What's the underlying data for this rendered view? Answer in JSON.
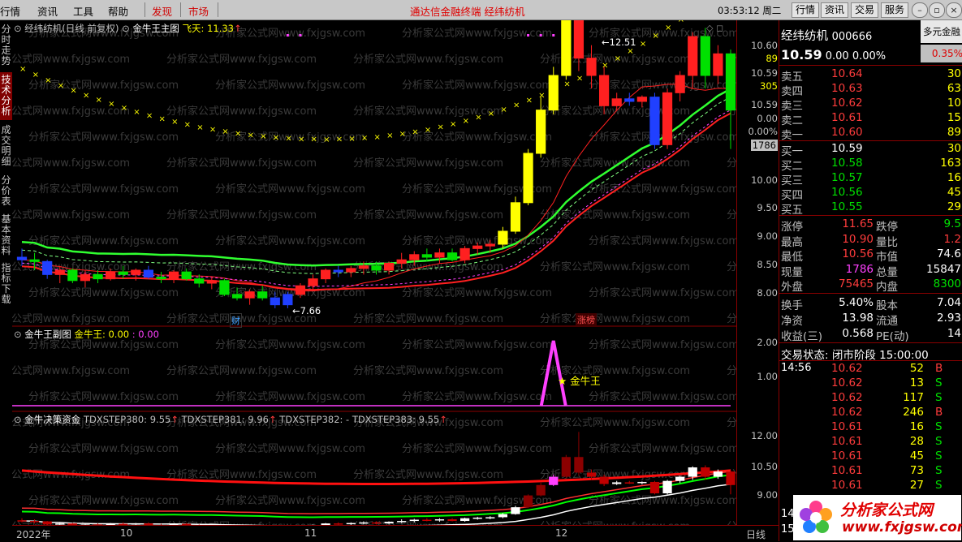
{
  "menu": {
    "items": [
      "行情",
      "资讯",
      "工具",
      "帮助"
    ],
    "red_items": [
      "发现",
      "市场"
    ],
    "title": "通达信金融终端  经纬纺机",
    "clock": "03:53:12 周二",
    "buttons": [
      "行情",
      "资讯",
      "交易",
      "服务"
    ]
  },
  "left_tabs": [
    {
      "label": "分时走势",
      "active": false
    },
    {
      "label": "技术分析",
      "active": true
    },
    {
      "label": "成交明细",
      "active": false
    },
    {
      "label": "分价表",
      "active": false
    },
    {
      "label": "基本资料",
      "active": false
    },
    {
      "label": "指标下载",
      "active": false
    }
  ],
  "main_pane": {
    "title": "经纬纺机(日线 前复权)",
    "indicator": "金牛王主图",
    "fly_label": "飞天: 11.33",
    "high_label": "12.51",
    "low_label": "7.66",
    "badge_cai": "财",
    "badge_zhb": "涨榜",
    "y_labels": [
      "10.60",
      "89",
      "10.59",
      "305",
      "10.59",
      "0.00",
      "0.00%",
      "1786",
      "10.00",
      "9.50",
      "9.00",
      "8.50",
      "8.00"
    ]
  },
  "sub_pane": {
    "title": "金牛王副图",
    "value_label": "金牛王: 0.00",
    "value2": ": 0.00",
    "star_label": "★ 金牛王",
    "y_labels": [
      "2.00",
      "1.00"
    ]
  },
  "bottom_pane": {
    "title": "金牛决策资金",
    "s380": "TDXSTEP380: 9.55",
    "s381": "TDXSTEP381: 9.96",
    "s382": "TDXSTEP382: -",
    "s383": "TDXSTEP383: 9.55",
    "y_labels": [
      "12.00",
      "10.50",
      "9.00"
    ]
  },
  "x_axis": {
    "labels": [
      "2022年",
      "10",
      "11",
      "12"
    ],
    "period": "日线"
  },
  "quote": {
    "name": "经纬纺机",
    "code": "000666",
    "side_label": "多元金融",
    "price": "10.59",
    "change": "0.00",
    "change_pct": "0.00%",
    "side_pct": "0.35%",
    "asks": [
      {
        "label": "卖五",
        "price": "10.64",
        "vol": "30"
      },
      {
        "label": "卖四",
        "price": "10.63",
        "vol": "63"
      },
      {
        "label": "卖三",
        "price": "10.62",
        "vol": "10"
      },
      {
        "label": "卖二",
        "price": "10.61",
        "vol": "15"
      },
      {
        "label": "卖一",
        "price": "10.60",
        "vol": "89"
      }
    ],
    "bids": [
      {
        "label": "买一",
        "price": "10.59",
        "vol": "30"
      },
      {
        "label": "买二",
        "price": "10.58",
        "vol": "163"
      },
      {
        "label": "买三",
        "price": "10.57",
        "vol": "16"
      },
      {
        "label": "买四",
        "price": "10.56",
        "vol": "45"
      },
      {
        "label": "买五",
        "price": "10.55",
        "vol": "29"
      }
    ],
    "stats": [
      {
        "l1": "涨停",
        "v1": "11.65",
        "c1": "red",
        "l2": "跌停",
        "v2": "9.5",
        "c2": "green"
      },
      {
        "l1": "最高",
        "v1": "10.90",
        "c1": "red",
        "l2": "量比",
        "v2": "1.2",
        "c2": "red"
      },
      {
        "l1": "最低",
        "v1": "10.56",
        "c1": "red",
        "l2": "市值",
        "v2": "74.6",
        "c2": "white"
      },
      {
        "l1": "现量",
        "v1": "1786",
        "c1": "magenta",
        "l2": "总量",
        "v2": "15847",
        "c2": "white"
      },
      {
        "l1": "外盘",
        "v1": "75465",
        "c1": "red",
        "l2": "内盘",
        "v2": "8300",
        "c2": "green"
      }
    ],
    "fund": [
      {
        "l1": "换手",
        "v1": "5.40%",
        "l2": "股本",
        "v2": "7.04"
      },
      {
        "l1": "净资",
        "v1": "13.98",
        "l2": "流通",
        "v2": "2.93"
      },
      {
        "l1": "收益(三)",
        "v1": "0.568",
        "l2": "PE(动)",
        "v2": "14"
      }
    ],
    "status_label": "交易状态: 闭市阶段 15:00:00",
    "ticks_time": "14:56",
    "ticks": [
      {
        "price": "10.62",
        "vol": "52",
        "side": "B"
      },
      {
        "price": "10.62",
        "vol": "13",
        "side": "S"
      },
      {
        "price": "10.62",
        "vol": "117",
        "side": "S"
      },
      {
        "price": "10.62",
        "vol": "246",
        "side": "B"
      },
      {
        "price": "10.61",
        "vol": "16",
        "side": "S"
      },
      {
        "price": "10.61",
        "vol": "28",
        "side": "S"
      },
      {
        "price": "10.61",
        "vol": "45",
        "side": "S"
      },
      {
        "price": "10.61",
        "vol": "73",
        "side": "S"
      },
      {
        "price": "10.61",
        "vol": "27",
        "side": "S"
      }
    ],
    "tick_tail": [
      "14",
      "15"
    ]
  },
  "watermark": {
    "text": "分析家公式网",
    "url": "www.fxjgsw.com"
  },
  "colors": {
    "up": "#ff2020",
    "down": "#00e000",
    "bg": "#000000",
    "grid": "#8b0000"
  },
  "chart_data": {
    "type": "candlestick",
    "candles": [
      [
        8.25,
        8.35,
        8.15,
        8.22
      ],
      [
        8.22,
        8.3,
        8.1,
        8.2
      ],
      [
        8.2,
        8.22,
        8.0,
        8.05
      ],
      [
        8.05,
        8.15,
        7.95,
        8.1
      ],
      [
        8.1,
        8.12,
        7.95,
        7.98
      ],
      [
        7.98,
        8.1,
        7.9,
        8.05
      ],
      [
        8.05,
        8.1,
        7.95,
        8.0
      ],
      [
        8.0,
        8.12,
        7.98,
        8.08
      ],
      [
        8.08,
        8.15,
        8.0,
        8.05
      ],
      [
        8.05,
        8.12,
        7.98,
        8.1
      ],
      [
        8.1,
        8.15,
        8.0,
        8.02
      ],
      [
        8.02,
        8.08,
        7.95,
        8.0
      ],
      [
        8.0,
        8.1,
        7.95,
        8.08
      ],
      [
        8.08,
        8.12,
        7.98,
        8.0
      ],
      [
        8.0,
        8.05,
        7.9,
        7.95
      ],
      [
        7.95,
        8.02,
        7.88,
        7.98
      ],
      [
        7.98,
        8.0,
        7.8,
        7.82
      ],
      [
        7.82,
        7.9,
        7.75,
        7.78
      ],
      [
        7.78,
        7.88,
        7.7,
        7.85
      ],
      [
        7.85,
        7.92,
        7.75,
        7.78
      ],
      [
        7.78,
        7.85,
        7.66,
        7.7
      ],
      [
        7.7,
        7.85,
        7.66,
        7.82
      ],
      [
        7.82,
        7.95,
        7.78,
        7.92
      ],
      [
        7.92,
        8.05,
        7.88,
        8.0
      ],
      [
        8.0,
        8.12,
        7.95,
        8.1
      ],
      [
        8.1,
        8.15,
        8.02,
        8.08
      ],
      [
        8.08,
        8.15,
        8.02,
        8.12
      ],
      [
        8.12,
        8.2,
        8.05,
        8.15
      ],
      [
        8.15,
        8.2,
        8.05,
        8.1
      ],
      [
        8.1,
        8.2,
        8.05,
        8.18
      ],
      [
        8.18,
        8.3,
        8.12,
        8.22
      ],
      [
        8.22,
        8.32,
        8.15,
        8.28
      ],
      [
        8.28,
        8.35,
        8.2,
        8.25
      ],
      [
        8.25,
        8.35,
        8.18,
        8.3
      ],
      [
        8.3,
        8.35,
        8.2,
        8.22
      ],
      [
        8.22,
        8.38,
        8.18,
        8.35
      ],
      [
        8.35,
        8.42,
        8.28,
        8.38
      ],
      [
        8.38,
        8.45,
        8.3,
        8.4
      ],
      [
        8.4,
        8.6,
        8.35,
        8.55
      ],
      [
        8.55,
        8.95,
        8.52,
        8.88
      ],
      [
        8.88,
        9.5,
        8.85,
        9.45
      ],
      [
        9.45,
        10.1,
        9.4,
        9.95
      ],
      [
        9.95,
        10.45,
        9.9,
        10.35
      ],
      [
        10.35,
        11.4,
        10.3,
        11.3
      ],
      [
        11.3,
        12.51,
        10.4,
        10.55
      ],
      [
        10.55,
        10.7,
        10.2,
        10.35
      ],
      [
        10.35,
        10.45,
        9.9,
        10.0
      ],
      [
        10.0,
        10.15,
        9.95,
        10.08
      ],
      [
        10.08,
        10.15,
        10.0,
        10.05
      ],
      [
        10.05,
        10.12,
        9.98,
        10.1
      ],
      [
        10.1,
        10.15,
        9.5,
        9.55
      ],
      [
        9.55,
        10.2,
        9.5,
        10.15
      ],
      [
        10.15,
        10.4,
        10.05,
        10.35
      ],
      [
        10.35,
        10.85,
        10.2,
        10.8
      ],
      [
        10.8,
        10.9,
        10.2,
        10.35
      ],
      [
        10.35,
        10.7,
        10.25,
        10.6
      ],
      [
        10.6,
        10.65,
        9.5,
        9.95
      ]
    ],
    "fly_value": 11.33,
    "jinniuwang_value": 0.0,
    "tdxstep380": 9.55,
    "tdxstep381": 9.96,
    "tdxstep383": 9.55,
    "y_range_main": [
      7.5,
      10.8
    ]
  }
}
